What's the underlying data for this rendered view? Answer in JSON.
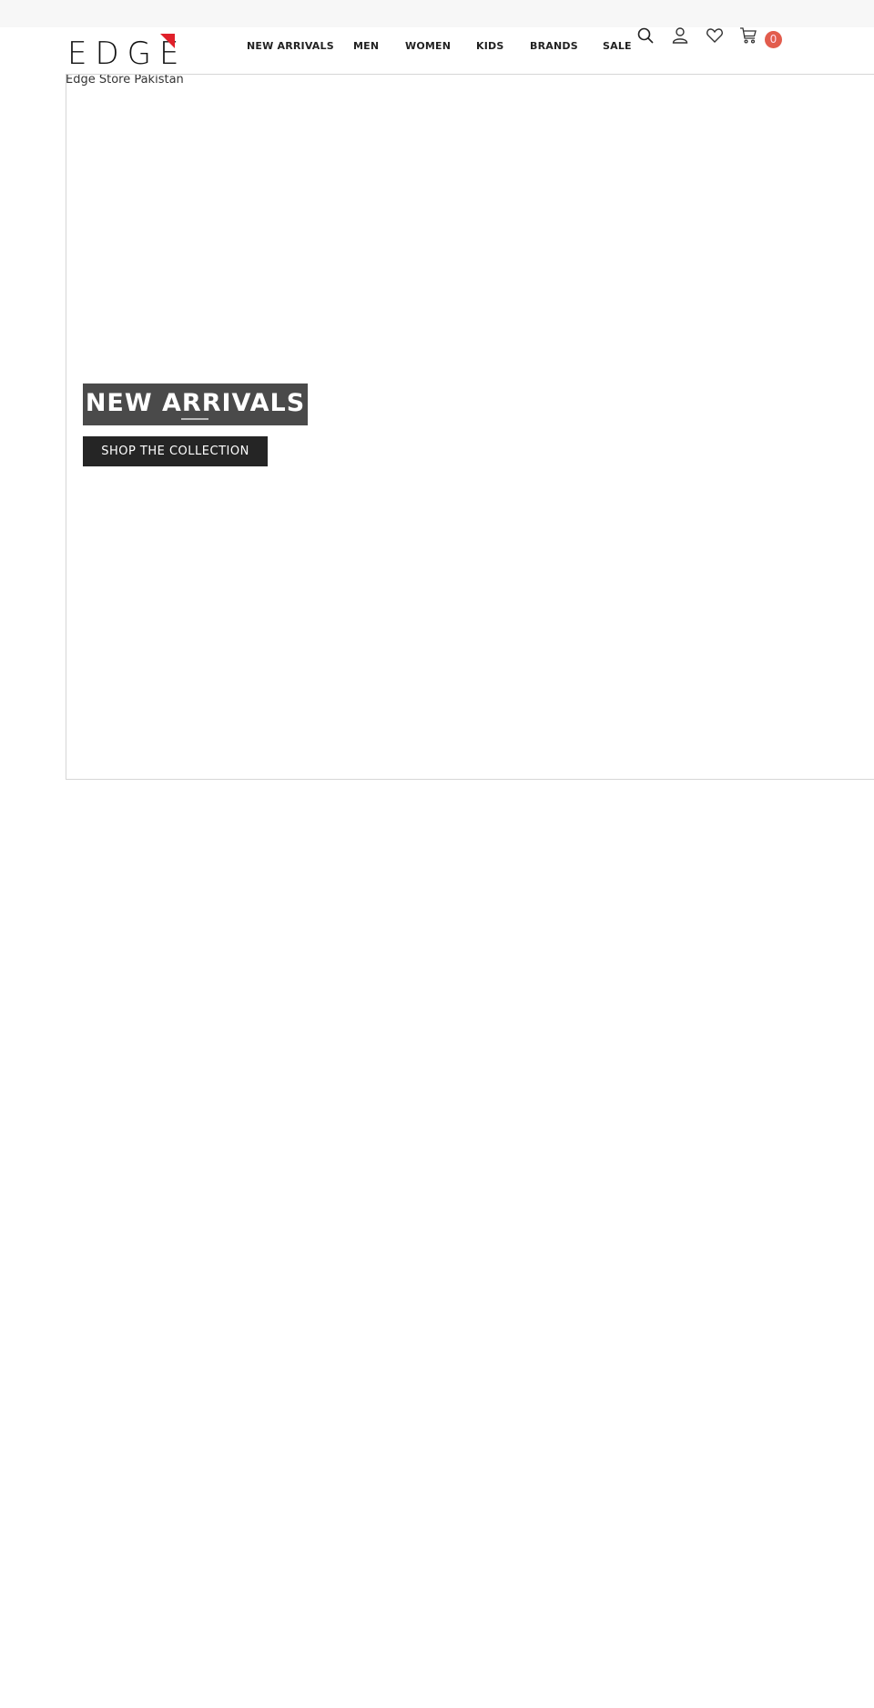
{
  "brand": {
    "logo_text": "EDGE",
    "store_name": "Edge Store Pakistan",
    "accent": "#e0202a"
  },
  "nav": {
    "items": [
      {
        "label": "NEW ARRIVALS"
      },
      {
        "label": "MEN"
      },
      {
        "label": "WOMEN"
      },
      {
        "label": "KIDS"
      },
      {
        "label": "BRANDS"
      },
      {
        "label": "SALE"
      }
    ]
  },
  "header_icons": {
    "search": "search-icon",
    "account": "user-icon",
    "wishlist": "heart-icon",
    "cart": "cart-icon",
    "cart_count": "0",
    "badge_color": "#e25c4d"
  },
  "hero": {
    "title": "NEW ARRIVALS",
    "cta_label": "SHOP THE COLLECTION"
  }
}
